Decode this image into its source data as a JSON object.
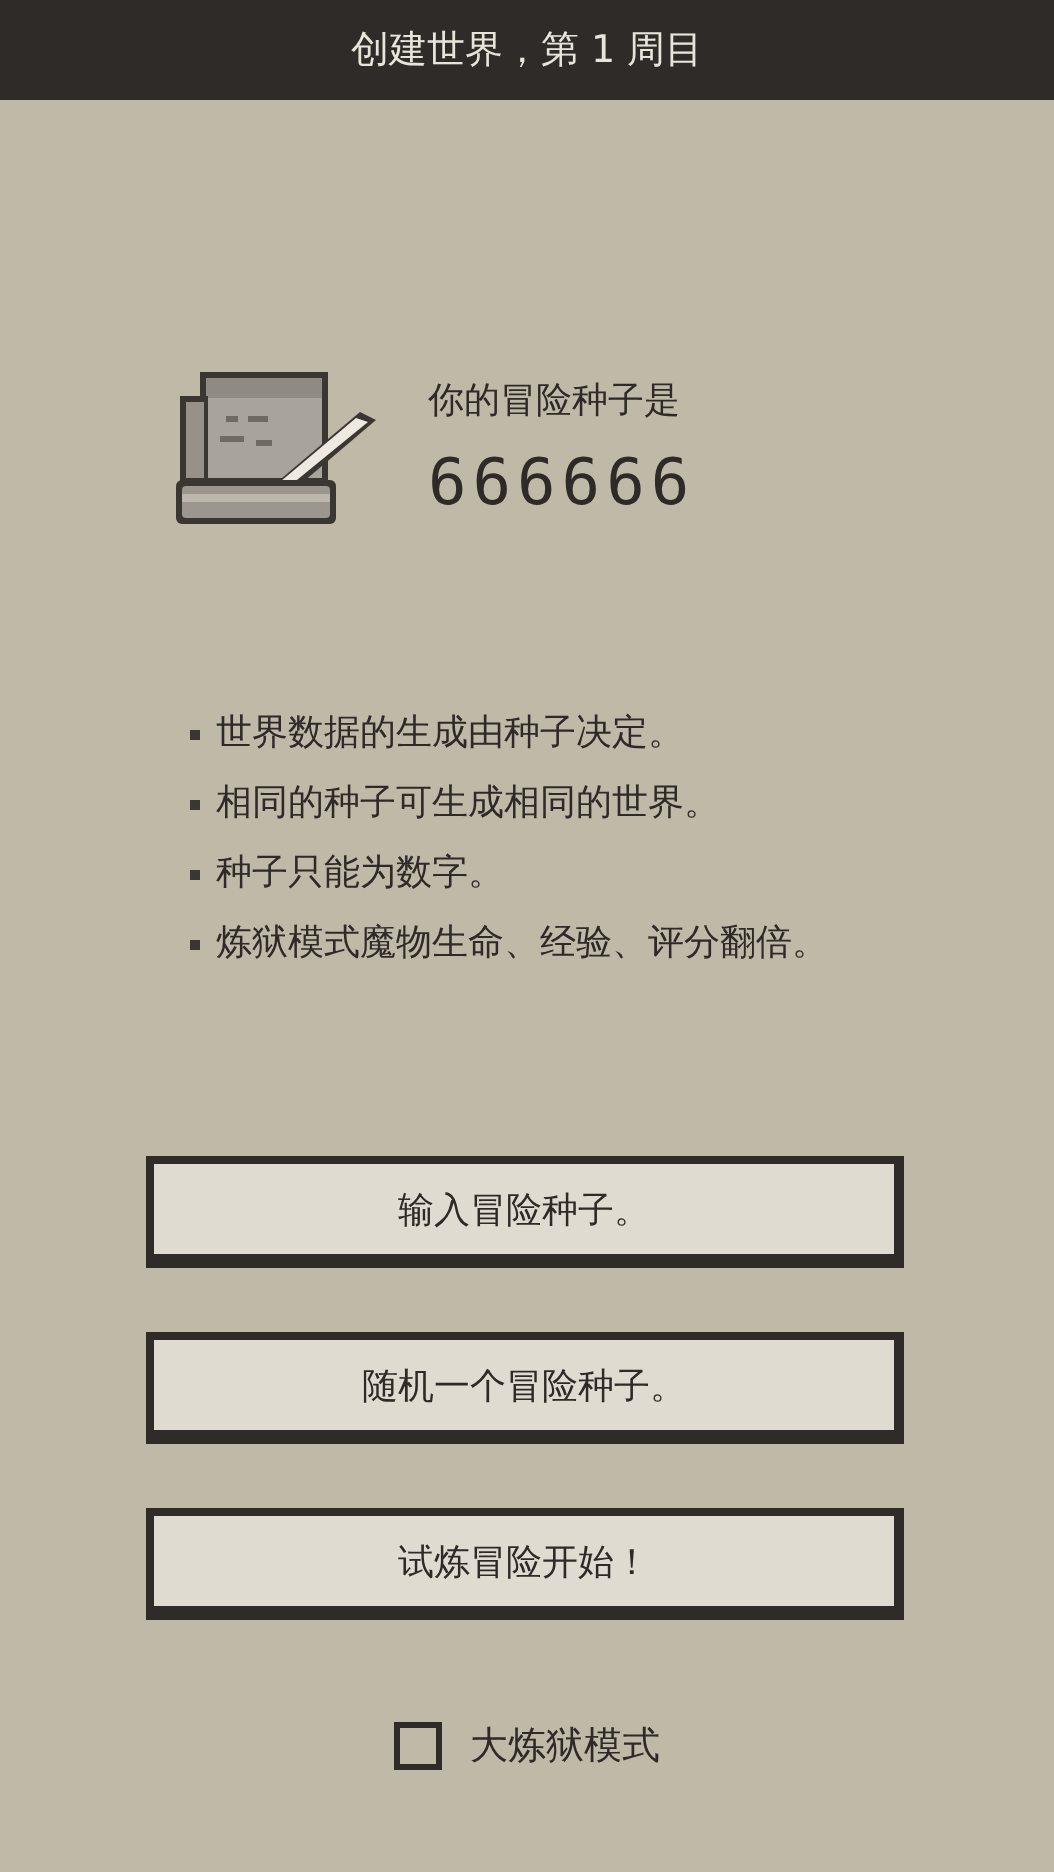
{
  "header": {
    "title": "创建世界，第 1 周目"
  },
  "seed": {
    "label": "你的冒险种子是",
    "value": "666666"
  },
  "notes": [
    "世界数据的生成由种子决定。",
    "相同的种子可生成相同的世界。",
    "种子只能为数字。",
    "炼狱模式魔物生命、经验、评分翻倍。"
  ],
  "buttons": [
    "输入冒险种子。",
    "随机一个冒险种子。",
    "试炼冒险开始！"
  ],
  "option": {
    "label": "大炼狱模式",
    "checked": false
  }
}
